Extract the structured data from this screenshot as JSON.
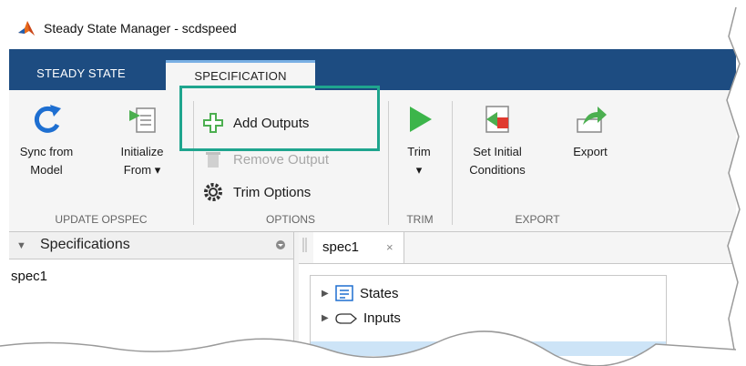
{
  "window": {
    "title": "Steady State Manager - scdspeed"
  },
  "tabs": [
    {
      "label": "STEADY STATE"
    },
    {
      "label": "SPECIFICATION"
    }
  ],
  "ribbon": {
    "groups": {
      "update_opspec": "UPDATE OPSPEC",
      "options": "OPTIONS",
      "trim": "TRIM",
      "export": "EXPORT"
    },
    "sync": {
      "line1": "Sync from",
      "line2": "Model"
    },
    "initialize": {
      "line1": "Initialize",
      "line2": "From ▾"
    },
    "add_outputs": "Add Outputs",
    "remove_output": "Remove Output",
    "trim_options": "Trim Options",
    "trim": {
      "line1": "Trim",
      "line2": "▾"
    },
    "set_initial": {
      "line1": "Set Initial",
      "line2": "Conditions"
    },
    "export": "Export"
  },
  "left_panel": {
    "title": "Specifications",
    "items": [
      "spec1"
    ]
  },
  "document": {
    "tab_label": "spec1",
    "tab_close": "×",
    "tree": [
      {
        "label": "States"
      },
      {
        "label": "Inputs"
      }
    ]
  },
  "colors": {
    "tab_bar": "#1d4c81",
    "highlight": "#1fa58e",
    "add_icon": "#4caf50",
    "trim_icon": "#3cb54a"
  }
}
